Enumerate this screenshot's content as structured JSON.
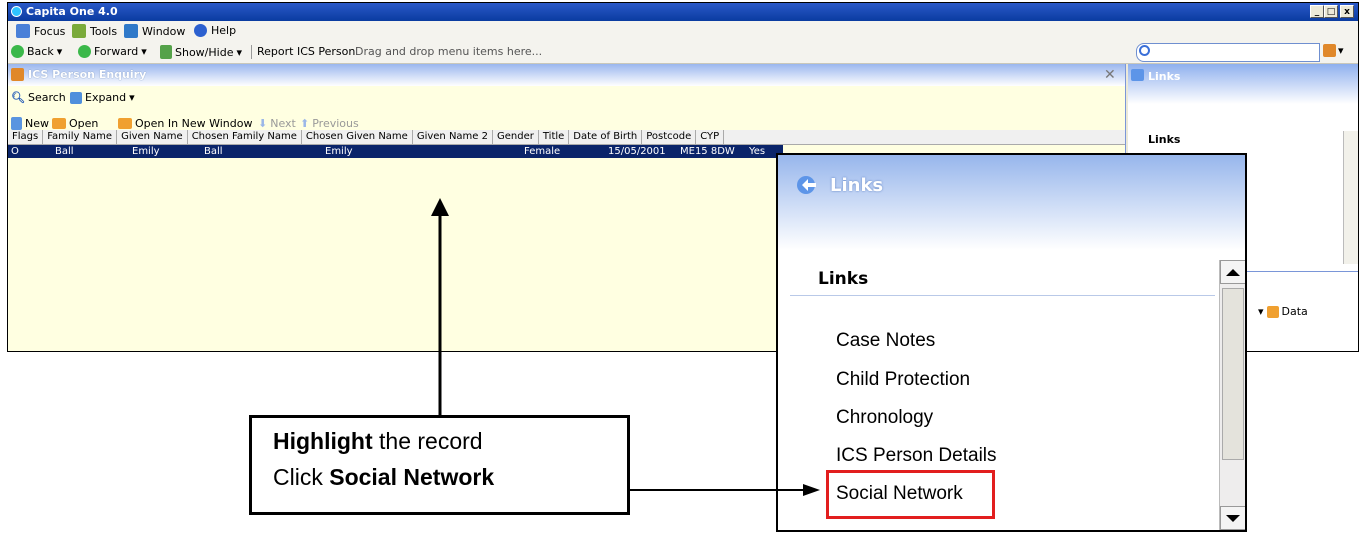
{
  "window": {
    "title": "Capita One 4.0",
    "controls": [
      "_",
      "□",
      "x"
    ]
  },
  "menu": {
    "items": [
      {
        "label": "Focus",
        "icon": "focus-icon",
        "color": "#4a80d8"
      },
      {
        "label": "Tools",
        "icon": "tools-icon",
        "color": "#7aaa3a"
      },
      {
        "label": "Window",
        "icon": "window-icon",
        "color": "#2f79c9"
      },
      {
        "label": "Help",
        "icon": "help-icon",
        "color": "#2c60cf"
      }
    ]
  },
  "nav": {
    "back": "Back",
    "forward": "Forward",
    "show_hide": "Show/Hide",
    "report": "Report",
    "ics_person": "ICS Person",
    "drag_hint": "Drag and drop menu items here..."
  },
  "enquiry": {
    "title": "ICS Person Enquiry",
    "toolbar1": {
      "search": "Search",
      "expand": "Expand"
    },
    "toolbar2": {
      "new": "New",
      "open": "Open",
      "open_new_window": "Open In New Window",
      "next": "Next",
      "previous": "Previous"
    },
    "columns": [
      "Flags",
      "Family Name",
      "Given Name",
      "Chosen Family Name",
      "Chosen Given Name",
      "Given Name 2",
      "Gender",
      "Title",
      "Date of Birth",
      "Postcode",
      "CYP"
    ],
    "row": {
      "flags": "O",
      "family_name": "Ball",
      "given_name": "Emily",
      "chosen_family_name": "Ball",
      "chosen_given_name": "Emily",
      "given_name_2": "",
      "gender": "Female",
      "title": "",
      "dob": "15/05/2001",
      "postcode": "ME15 8DW",
      "cyp": "Yes"
    }
  },
  "links_panel": {
    "title": "Links",
    "subtitle": "Links",
    "data_button": "Data"
  },
  "zoom": {
    "title": "Links",
    "subtitle": "Links",
    "items": [
      "Case Notes",
      "Child Protection",
      "Chronology",
      "ICS Person Details",
      "Social Network"
    ],
    "highlight_color": "#e21e1e"
  },
  "callout": {
    "line1_bold": "Highlight",
    "line1_rest": " the record",
    "line2_prefix": "Click ",
    "line2_bold": "Social Network"
  }
}
